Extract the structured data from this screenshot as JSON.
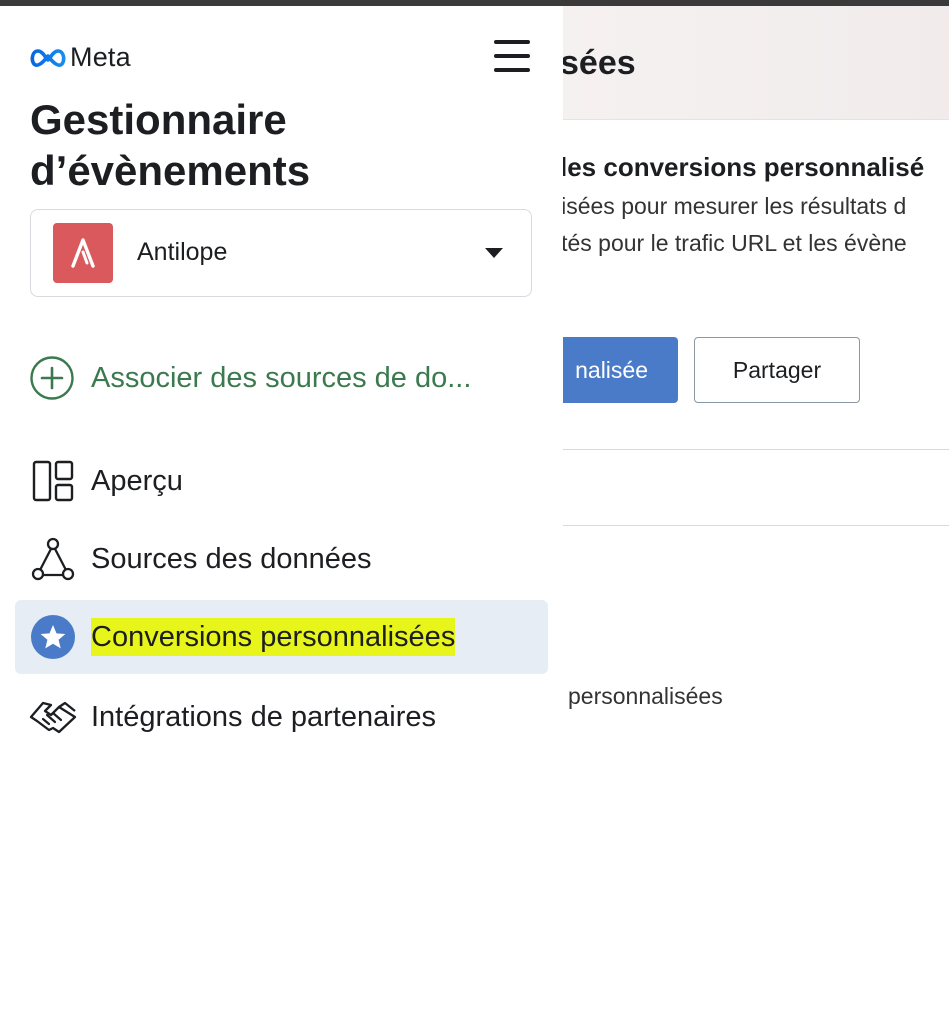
{
  "background_page": {
    "title_fragment": "sées",
    "section_heading_fragment": "les conversions personnalisé",
    "description_line1_fragment": "lisées pour mesurer les résultats d",
    "description_line2_fragment": "ités pour le trafic URL et les évène",
    "primary_button_fragment": "nalisée",
    "share_button": "Partager",
    "empty_text_fragment": "personnalisées"
  },
  "sidebar": {
    "logo_text": "Meta",
    "app_title": "Gestionnaire d’évènements",
    "account": {
      "name": "Antilope",
      "avatar_color": "#d9595c"
    },
    "connect_sources_label": "Associer des sources de do...",
    "nav": [
      {
        "label": "Aperçu",
        "icon": "overview-grid-icon"
      },
      {
        "label": "Sources des données",
        "icon": "data-sources-icon"
      },
      {
        "label": "Conversions personnalisées",
        "icon": "star-circle-icon",
        "active": true
      },
      {
        "label": "Intégrations de partenaires",
        "icon": "handshake-icon"
      }
    ]
  },
  "colors": {
    "primary_blue": "#4a7bc8",
    "connect_green": "#3b7a4f",
    "active_bg": "#e7edf5",
    "highlight_yellow": "#e8f51a"
  }
}
